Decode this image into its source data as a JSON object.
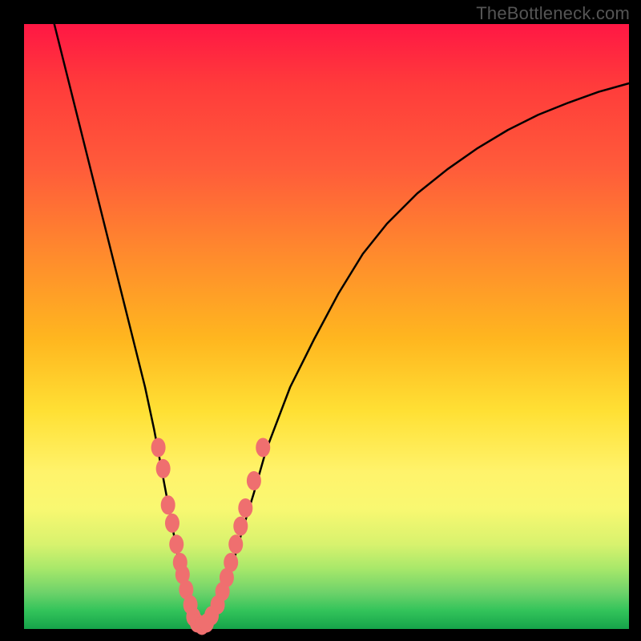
{
  "watermark": "TheBottleneck.com",
  "chart_data": {
    "type": "line",
    "title": "",
    "xlabel": "",
    "ylabel": "",
    "xlim": [
      0,
      1
    ],
    "ylim": [
      0,
      1
    ],
    "curve": {
      "name": "bottleneck-curve",
      "description": "V-shaped curve, minimum near x≈0.28, y≈0",
      "points": [
        {
          "x": 0.05,
          "y": 1.0
        },
        {
          "x": 0.075,
          "y": 0.9
        },
        {
          "x": 0.1,
          "y": 0.8
        },
        {
          "x": 0.125,
          "y": 0.7
        },
        {
          "x": 0.15,
          "y": 0.6
        },
        {
          "x": 0.175,
          "y": 0.5
        },
        {
          "x": 0.2,
          "y": 0.4
        },
        {
          "x": 0.215,
          "y": 0.33
        },
        {
          "x": 0.23,
          "y": 0.25
        },
        {
          "x": 0.245,
          "y": 0.17
        },
        {
          "x": 0.26,
          "y": 0.09
        },
        {
          "x": 0.27,
          "y": 0.04
        },
        {
          "x": 0.28,
          "y": 0.01
        },
        {
          "x": 0.29,
          "y": 0.0
        },
        {
          "x": 0.3,
          "y": 0.005
        },
        {
          "x": 0.32,
          "y": 0.035
        },
        {
          "x": 0.34,
          "y": 0.09
        },
        {
          "x": 0.36,
          "y": 0.16
        },
        {
          "x": 0.38,
          "y": 0.225
        },
        {
          "x": 0.4,
          "y": 0.295
        },
        {
          "x": 0.44,
          "y": 0.4
        },
        {
          "x": 0.48,
          "y": 0.48
        },
        {
          "x": 0.52,
          "y": 0.555
        },
        {
          "x": 0.56,
          "y": 0.62
        },
        {
          "x": 0.6,
          "y": 0.67
        },
        {
          "x": 0.65,
          "y": 0.72
        },
        {
          "x": 0.7,
          "y": 0.76
        },
        {
          "x": 0.75,
          "y": 0.795
        },
        {
          "x": 0.8,
          "y": 0.825
        },
        {
          "x": 0.85,
          "y": 0.85
        },
        {
          "x": 0.9,
          "y": 0.87
        },
        {
          "x": 0.95,
          "y": 0.888
        },
        {
          "x": 1.0,
          "y": 0.902
        }
      ]
    },
    "markers": {
      "name": "highlight-markers",
      "color_hex": "#ef6f6f",
      "description": "Pink rounded markers clustered near the curve's trough on both branches",
      "points": [
        {
          "x": 0.222,
          "y": 0.3
        },
        {
          "x": 0.23,
          "y": 0.265
        },
        {
          "x": 0.238,
          "y": 0.205
        },
        {
          "x": 0.245,
          "y": 0.175
        },
        {
          "x": 0.252,
          "y": 0.14
        },
        {
          "x": 0.258,
          "y": 0.11
        },
        {
          "x": 0.262,
          "y": 0.09
        },
        {
          "x": 0.268,
          "y": 0.065
        },
        {
          "x": 0.275,
          "y": 0.04
        },
        {
          "x": 0.28,
          "y": 0.02
        },
        {
          "x": 0.286,
          "y": 0.01
        },
        {
          "x": 0.294,
          "y": 0.006
        },
        {
          "x": 0.302,
          "y": 0.01
        },
        {
          "x": 0.31,
          "y": 0.022
        },
        {
          "x": 0.32,
          "y": 0.04
        },
        {
          "x": 0.328,
          "y": 0.062
        },
        {
          "x": 0.335,
          "y": 0.085
        },
        {
          "x": 0.342,
          "y": 0.11
        },
        {
          "x": 0.35,
          "y": 0.14
        },
        {
          "x": 0.358,
          "y": 0.17
        },
        {
          "x": 0.366,
          "y": 0.2
        },
        {
          "x": 0.38,
          "y": 0.245
        },
        {
          "x": 0.395,
          "y": 0.3
        }
      ]
    }
  },
  "colors": {
    "marker_fill": "#ef6f6f",
    "curve_stroke": "#000000",
    "frame_bg": "#000000",
    "watermark_text": "#555555"
  }
}
